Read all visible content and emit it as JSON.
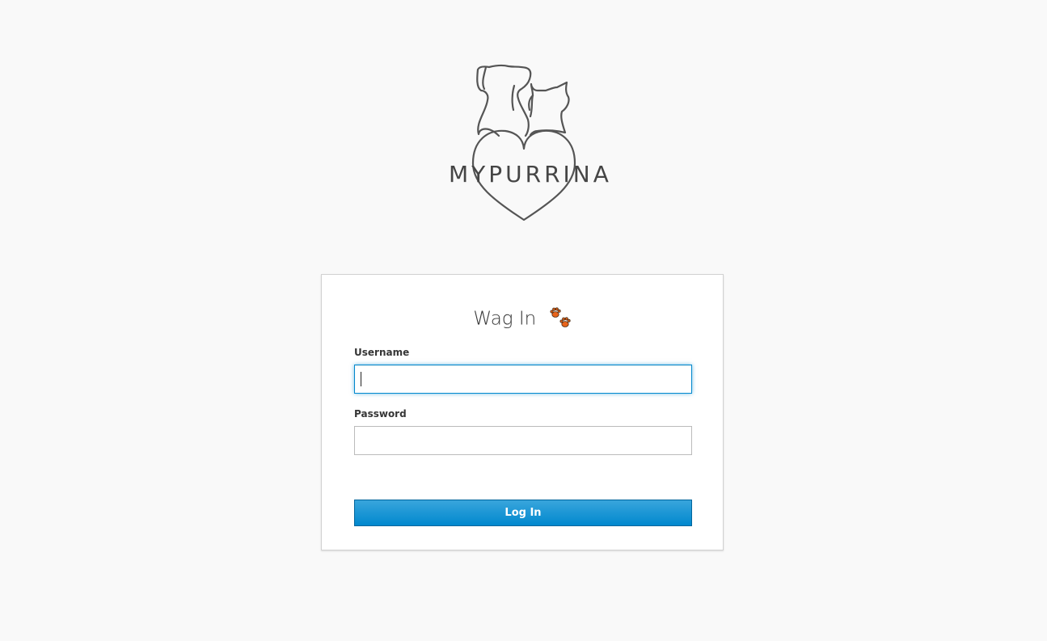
{
  "brand": {
    "name": "MYPURRINA",
    "logo_icon": "dog-cat-heart-icon"
  },
  "login": {
    "title": "Wag In",
    "title_icon": "paw-prints-icon",
    "username_label": "Username",
    "username_value": "",
    "password_label": "Password",
    "password_value": "",
    "submit_label": "Log In"
  },
  "colors": {
    "background": "#f9f9f9",
    "accent": "#0088ce",
    "button_gradient_top": "#39a5dc",
    "paw": "#e8641b"
  }
}
